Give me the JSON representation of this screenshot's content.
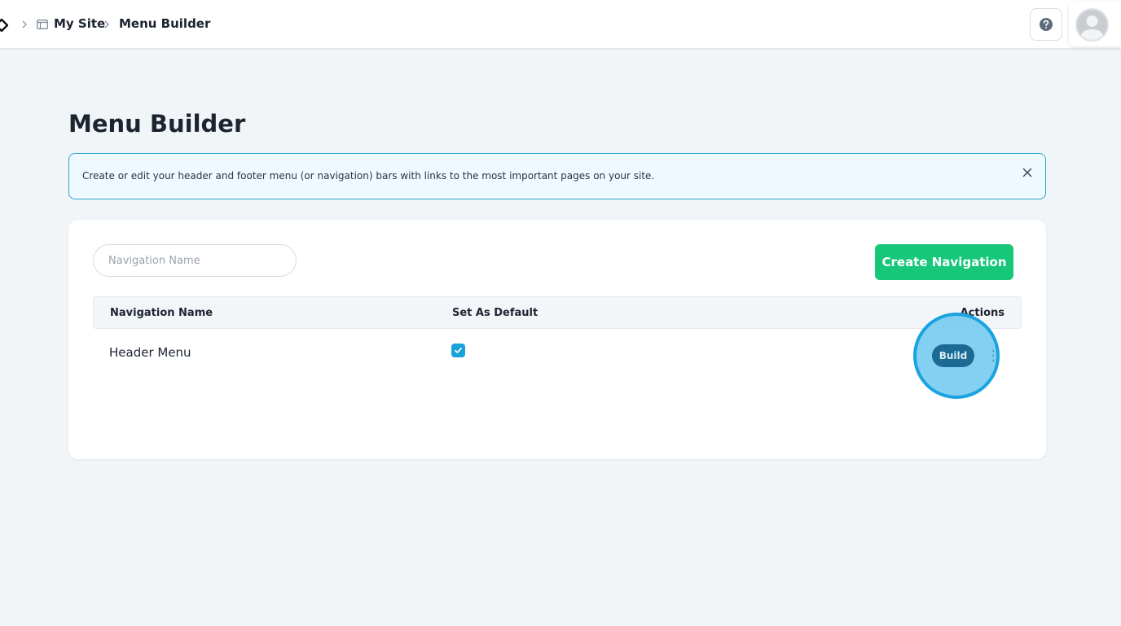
{
  "breadcrumb": {
    "site": "My Site",
    "page": "Menu Builder"
  },
  "page": {
    "title": "Menu Builder"
  },
  "banner": {
    "text": "Create or edit your header and footer menu (or navigation) bars with links to the most important pages on your site."
  },
  "toolbar": {
    "search_placeholder": "Navigation Name",
    "create_label": "Create Navigation"
  },
  "table": {
    "columns": [
      "Navigation Name",
      "Set As Default",
      "Actions"
    ],
    "rows": [
      {
        "name": "Header Menu",
        "is_default": true,
        "action": "Build"
      }
    ]
  },
  "colors": {
    "accent_green": "#16c77a",
    "accent_blue": "#1aa3d9",
    "banner_border": "#2aa7c9",
    "build_button": "#1a6a93"
  },
  "icons": {
    "logo": "diamond-logo-icon",
    "site": "window-icon",
    "help": "question-circle-icon",
    "close": "close-icon",
    "check": "check-icon"
  }
}
